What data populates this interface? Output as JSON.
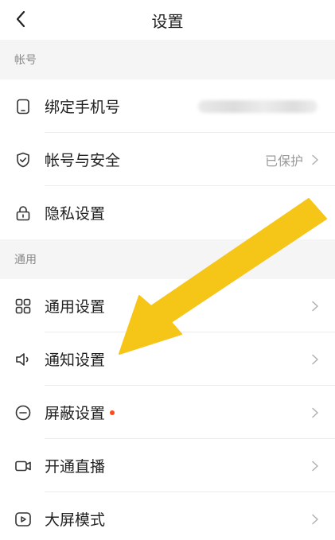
{
  "header": {
    "title": "设置",
    "back_icon": "chevron-left-icon"
  },
  "sections": [
    {
      "title": "帐号",
      "items": [
        {
          "label": "绑定手机号",
          "icon": "phone-icon",
          "value": "",
          "value_blurred": true
        },
        {
          "label": "帐号与安全",
          "icon": "shield-check-icon",
          "value": "已保护",
          "chevron": true
        },
        {
          "label": "隐私设置",
          "icon": "lock-icon",
          "value": "",
          "chevron": false
        }
      ]
    },
    {
      "title": "通用",
      "items": [
        {
          "label": "通用设置",
          "icon": "grid-icon",
          "chevron": true
        },
        {
          "label": "通知设置",
          "icon": "speaker-icon",
          "chevron": true
        },
        {
          "label": "屏蔽设置",
          "icon": "minus-circle-icon",
          "badge_dot": true,
          "chevron": true
        },
        {
          "label": "开通直播",
          "icon": "video-camera-icon",
          "chevron": true
        },
        {
          "label": "大屏模式",
          "icon": "play-screen-icon",
          "chevron": true
        }
      ]
    }
  ],
  "colors": {
    "accent_arrow": "#f5c518",
    "badge_dot": "#ff4a1c",
    "section_bg": "#f5f5f5"
  }
}
